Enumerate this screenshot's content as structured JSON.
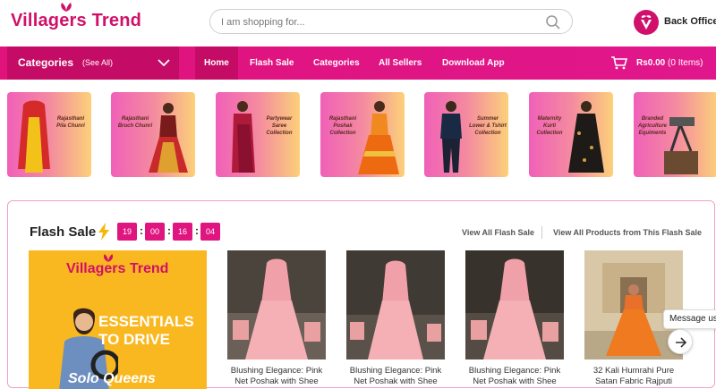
{
  "brand": {
    "name": "Villagers Trend",
    "color": "#d0106a"
  },
  "search": {
    "placeholder": "I am shopping for..."
  },
  "header": {
    "back_office": "Back Office"
  },
  "nav": {
    "categories_label": "Categories",
    "see_all": "(See All)",
    "items": [
      "Home",
      "Flash Sale",
      "Categories",
      "All Sellers",
      "Download App"
    ],
    "active": "Home"
  },
  "cart": {
    "amount": "Rs0.00",
    "items": "(0 Items)"
  },
  "categories": [
    {
      "label": "Rajasthani Pila Chunri"
    },
    {
      "label": "Rajasthani Bruch Chunri"
    },
    {
      "label": "Partywear Saree Collection"
    },
    {
      "label": "Rajasthani Poshak Collection"
    },
    {
      "label": "Summer Lower & Tshirt Collection"
    },
    {
      "label": "Maternity Kurti Collection"
    },
    {
      "label": "Branded Agriculture Equiments"
    }
  ],
  "flash": {
    "title": "Flash Sale",
    "timer": [
      "19",
      "00",
      "16",
      "04"
    ],
    "view_all": "View All Flash Sale",
    "view_all_products": "View All Products from This Flash Sale",
    "promo": {
      "brand": "Villagers Trend",
      "headline_1": "ESSENTIALS",
      "headline_2": "TO DRIVE",
      "tagline": "Solo Queens"
    },
    "products": [
      {
        "name": "Blushing Elegance: Pink Net Poshak with Shee"
      },
      {
        "name": "Blushing Elegance: Pink Net Poshak with Shee"
      },
      {
        "name": "Blushing Elegance: Pink Net Poshak with Shee"
      },
      {
        "name": "32 Kali Humrahi Pure Satan Fabric Rajputi"
      }
    ]
  },
  "chat": {
    "label": "Message us"
  },
  "colors": {
    "accent": "#e01580",
    "nav_dark": "#c40c66",
    "border": "#f0a0c8"
  },
  "icons": [
    "search-icon",
    "back-office-icon",
    "chevron-down-icon",
    "cart-icon",
    "lightning-icon",
    "arrow-right-icon"
  ]
}
